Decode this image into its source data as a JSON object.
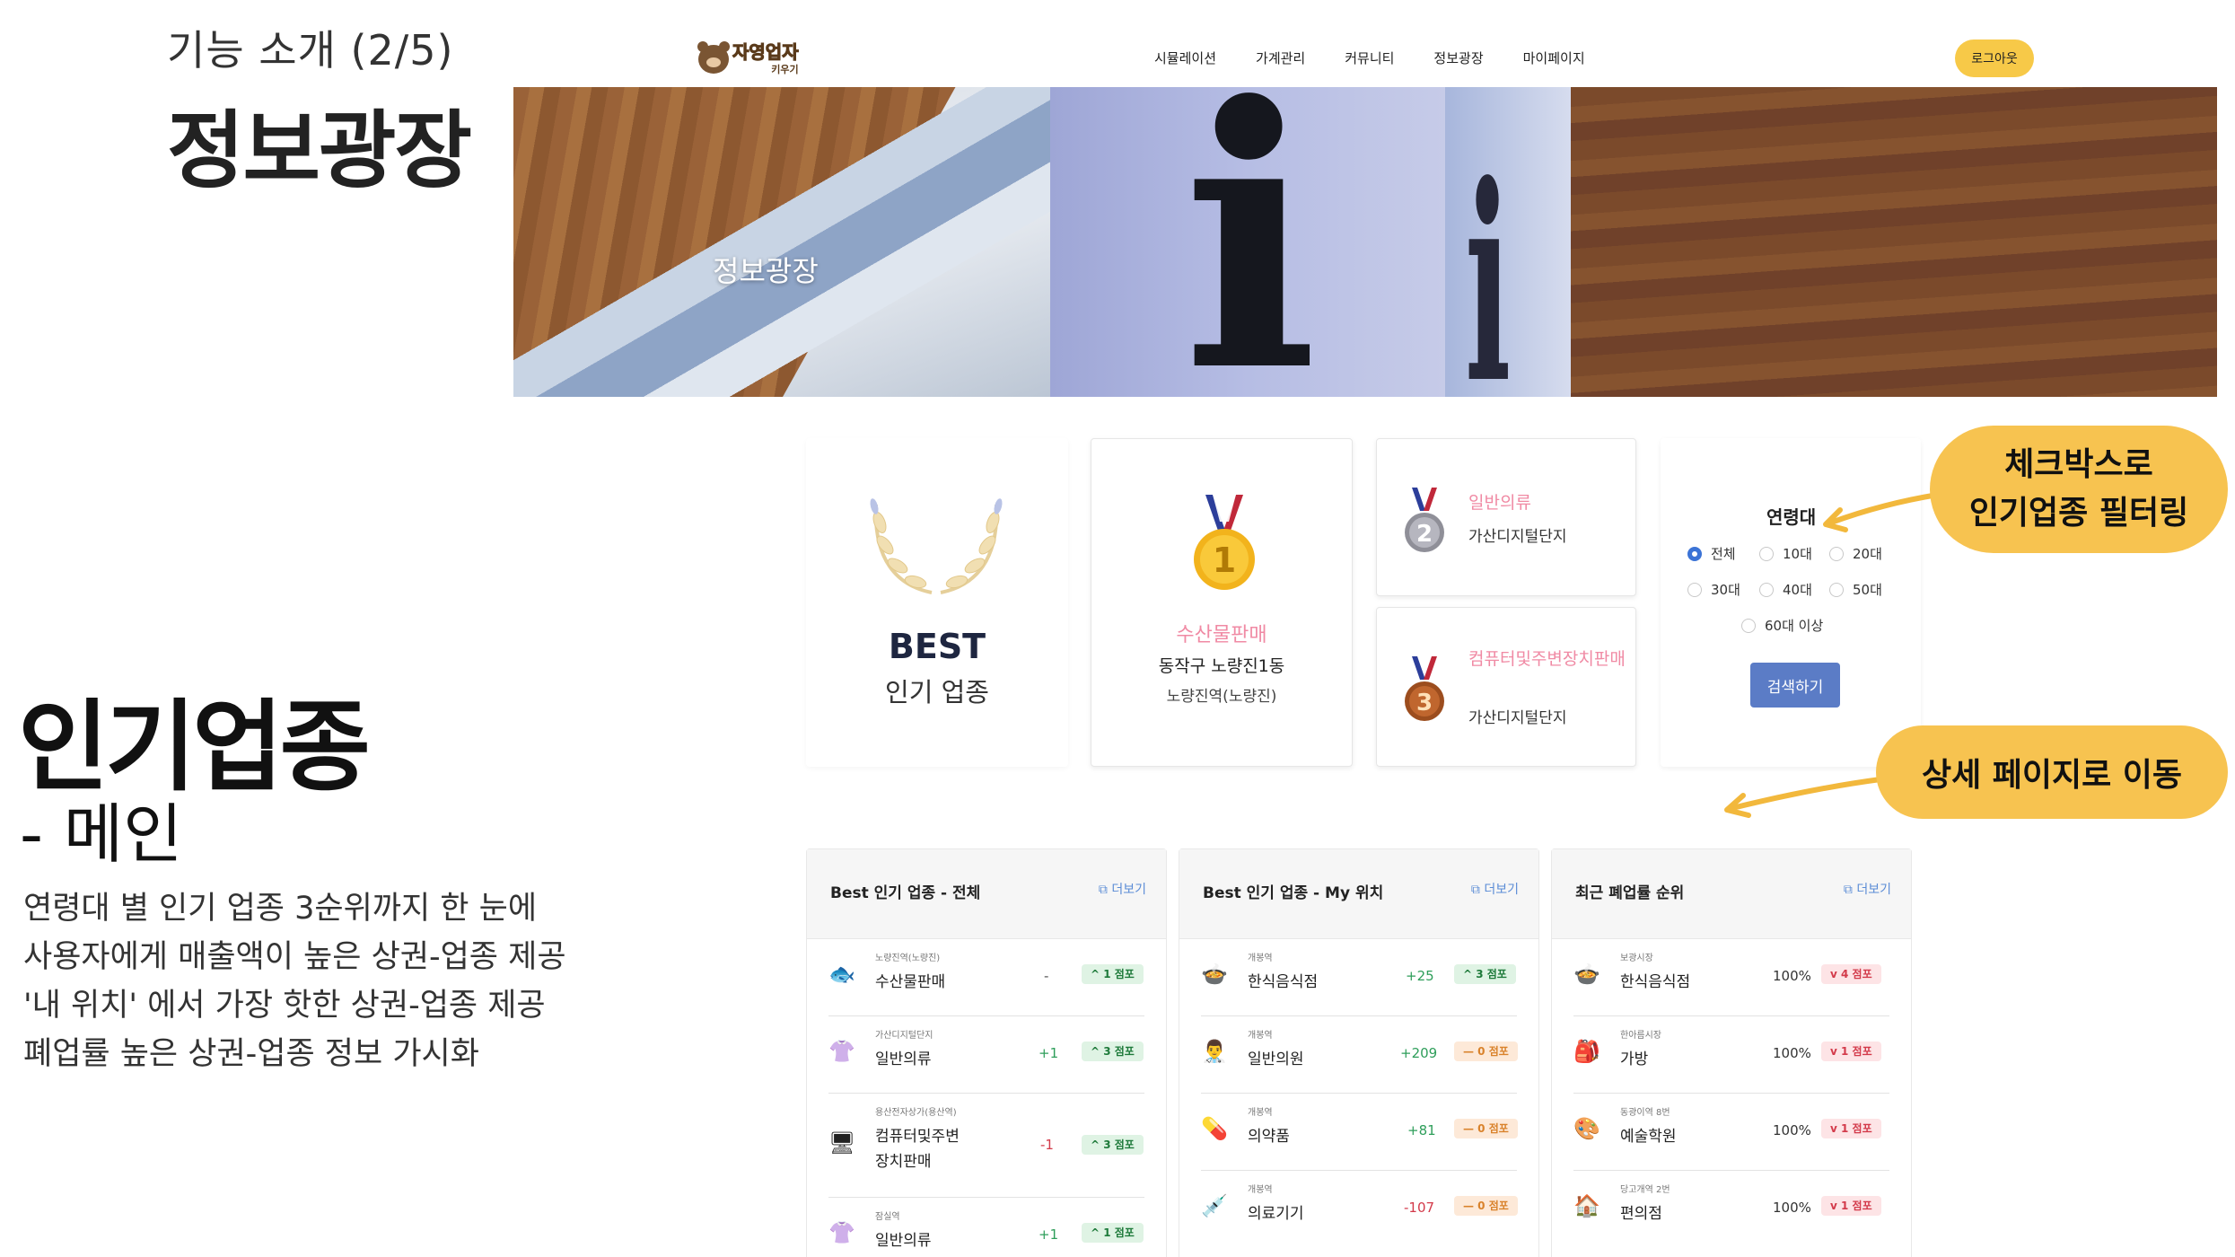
{
  "slide": {
    "subtitle": "기능 소개 (2/5)",
    "title": "정보광장",
    "section_title": "인기업종",
    "section_sub": "- 메인",
    "description": [
      "연령대 별 인기 업종 3순위까지 한 눈에",
      "사용자에게 매출액이 높은 상권-업종 제공",
      "'내 위치' 에서 가장 핫한 상권-업종 제공",
      "폐업률 높은 상권-업종 정보 가시화"
    ]
  },
  "header": {
    "logo_main": "자영업자",
    "logo_sub": "키우기",
    "nav": [
      "시뮬레이션",
      "가계관리",
      "커뮤니티",
      "정보광장",
      "마이페이지"
    ],
    "login_label": "로그아웃"
  },
  "hero": {
    "label": "정보광장"
  },
  "best": {
    "title": "BEST",
    "subtitle": "인기 업종",
    "first": {
      "rank": "1",
      "category": "수산물판매",
      "address": "동작구 노량진1동",
      "station": "노량진역(노량진)"
    },
    "second": {
      "rank": "2",
      "category": "일반의류",
      "area": "가산디지털단지"
    },
    "third": {
      "rank": "3",
      "category": "컴퓨터및주변장치판매",
      "area": "가산디지털단지"
    }
  },
  "filter": {
    "label": "연령대",
    "options": [
      "전체",
      "10대",
      "20대",
      "30대",
      "40대",
      "50대",
      "60대 이상"
    ],
    "selected": "전체",
    "search_label": "검색하기"
  },
  "callouts": {
    "checkbox_filter": [
      "체크박스로",
      "인기업종 필터링"
    ],
    "detail_page": "상세 페이지로 이동"
  },
  "panels": [
    {
      "title": "Best 인기 업종 - 전체",
      "more": "더보기",
      "rows": [
        {
          "icon": "fish-icon",
          "glyph": "🐟",
          "area": "노량진역(노량진)",
          "name": "수산물판매",
          "delta": "-",
          "badge": "^ 1 점포",
          "badge_type": "up"
        },
        {
          "icon": "shirt-icon",
          "glyph": "👚",
          "area": "가산디지털단지",
          "name": "일반의류",
          "delta": "+1",
          "badge": "^ 3 점포",
          "badge_type": "up"
        },
        {
          "icon": "computer-icon",
          "glyph": "🖥",
          "area": "용산전자상가(용산역)",
          "name": "컴퓨터및주변장치판매",
          "name_lines": [
            "컴퓨터및주변",
            "장치판매"
          ],
          "delta": "-1",
          "badge": "^ 3 점포",
          "badge_type": "up"
        },
        {
          "icon": "shirt-icon",
          "glyph": "👚",
          "area": "잠실역",
          "name": "일반의류",
          "delta": "+1",
          "badge": "^ 1 점포",
          "badge_type": "up"
        }
      ]
    },
    {
      "title": "Best 인기 업종 - My 위치",
      "more": "더보기",
      "rows": [
        {
          "icon": "korean-food-icon",
          "glyph": "🍲",
          "area": "개봉역",
          "name": "한식음식점",
          "delta": "+25",
          "badge": "^ 3 점포",
          "badge_type": "up"
        },
        {
          "icon": "doctor-icon",
          "glyph": "👨‍⚕️",
          "area": "개봉역",
          "name": "일반의원",
          "delta": "+209",
          "badge": "— 0 점포",
          "badge_type": "zero"
        },
        {
          "icon": "pill-icon",
          "glyph": "💊",
          "area": "개봉역",
          "name": "의약품",
          "delta": "+81",
          "badge": "— 0 점포",
          "badge_type": "zero"
        },
        {
          "icon": "syringe-icon",
          "glyph": "💉",
          "area": "개봉역",
          "name": "의료기기",
          "delta": "-107",
          "badge": "— 0 점포",
          "badge_type": "zero"
        }
      ]
    },
    {
      "title": "최근 폐업률 순위",
      "more": "더보기",
      "rows": [
        {
          "icon": "korean-food-icon",
          "glyph": "🍲",
          "area": "보광시장",
          "name": "한식음식점",
          "delta": "100%",
          "badge": "v 4 점포",
          "badge_type": "down"
        },
        {
          "icon": "bag-icon",
          "glyph": "🎒",
          "area": "한아름시장",
          "name": "가방",
          "delta": "100%",
          "badge": "v 1 점포",
          "badge_type": "down"
        },
        {
          "icon": "palette-icon",
          "glyph": "🎨",
          "area": "동광이역 8번",
          "name": "예술학원",
          "delta": "100%",
          "badge": "v 1 점포",
          "badge_type": "down"
        },
        {
          "icon": "store-icon",
          "glyph": "🏠",
          "area": "당고개역 2번",
          "name": "편의점",
          "delta": "100%",
          "badge": "v 1 점포",
          "badge_type": "down"
        }
      ]
    }
  ],
  "colors": {
    "accent": "#f7c350",
    "pink_category": "#f08aa4",
    "primary_button": "#5b7cc6",
    "link": "#5b8cd6",
    "up": "#1e7a3a",
    "zero": "#d9822b",
    "down": "#d33a4a"
  }
}
